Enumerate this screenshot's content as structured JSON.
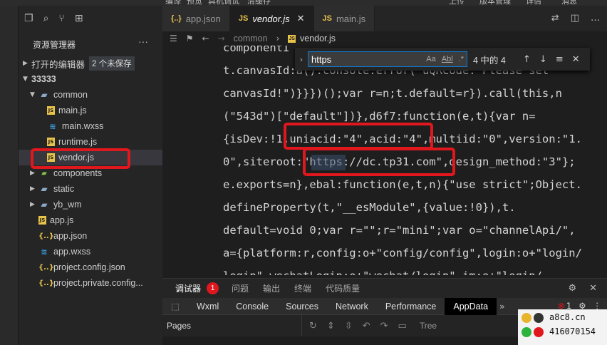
{
  "menubar": {
    "items": [
      "编译",
      "预览",
      "真机调试",
      "清缓存",
      "上传",
      "版本管理",
      "详情",
      "消息"
    ]
  },
  "sidebar": {
    "title": "资源管理器",
    "more": "···",
    "open_editors_label": "打开的编辑器",
    "unsaved_badge": "2 个未保存",
    "project": "33333",
    "tree": [
      {
        "label": "common",
        "type": "folder",
        "icon": "folder-open-icon"
      },
      {
        "label": "main.js",
        "type": "js"
      },
      {
        "label": "main.wxss",
        "type": "css"
      },
      {
        "label": "runtime.js",
        "type": "js"
      },
      {
        "label": "vendor.js",
        "type": "js",
        "selected": true
      },
      {
        "label": "components",
        "type": "folder"
      },
      {
        "label": "static",
        "type": "folder"
      },
      {
        "label": "yb_wm",
        "type": "folder"
      },
      {
        "label": "app.js",
        "type": "js"
      },
      {
        "label": "app.json",
        "type": "json"
      },
      {
        "label": "app.wxss",
        "type": "css"
      },
      {
        "label": "project.config.json",
        "type": "json"
      },
      {
        "label": "project.private.config...",
        "type": "json"
      }
    ]
  },
  "tabs": [
    {
      "label": "app.json",
      "icon": "{..}",
      "active": false
    },
    {
      "label": "vendor.js",
      "icon": "JS",
      "active": true,
      "close": "✕"
    },
    {
      "label": "main.js",
      "icon": "JS",
      "active": false
    }
  ],
  "breadcrumb": {
    "folder": "common",
    "file": "vendor.js"
  },
  "find": {
    "query": "https",
    "case_label": "Aa",
    "word_label": "Abl",
    "regex_label": ".*",
    "count": "4 中的 4"
  },
  "code_lines": [
    "componentI",
    "t.canvasId:a().console.error(\"uQRCode: Please set",
    "canvasId!\")}}})();var r=n;t.default=r}).call(this,n",
    "(\"543d\")[\"default\"])},d6f7:function(e,t){var n=",
    "{isDev:!1,uniacid:\"4\",acid:\"4\",multiid:\"0\",version:\"1.",
    "0\",siteroot:\"https://dc.tp31.com\",design_method:\"3\"};",
    "e.exports=n},ebal:function(e,t,n){\"use strict\";Object.",
    "defineProperty(t,\"__esModule\",{value:!0}),t.",
    "default=void 0;var r=\"\";r=\"mini\";var o=\"channelApi/\",",
    "a={platform:r,config:o+\"config/config\",login:o+\"login/",
    "login\",wechatLogin:o+\"wechat/login\",im:o+\"login/"
  ],
  "panel": {
    "tabs": [
      "调试器",
      "问题",
      "输出",
      "终端",
      "代码质量"
    ],
    "debugger_badge": "1"
  },
  "devtools": {
    "tabs": [
      "Wxml",
      "Console",
      "Sources",
      "Network",
      "Performance",
      "AppData"
    ],
    "active": "AppData",
    "more": "»",
    "error_count": "1"
  },
  "pages_bar": {
    "label": "Pages",
    "tree_label": "Tree"
  },
  "watermark": {
    "site": "a8c8.cn",
    "qq": "416070154"
  }
}
